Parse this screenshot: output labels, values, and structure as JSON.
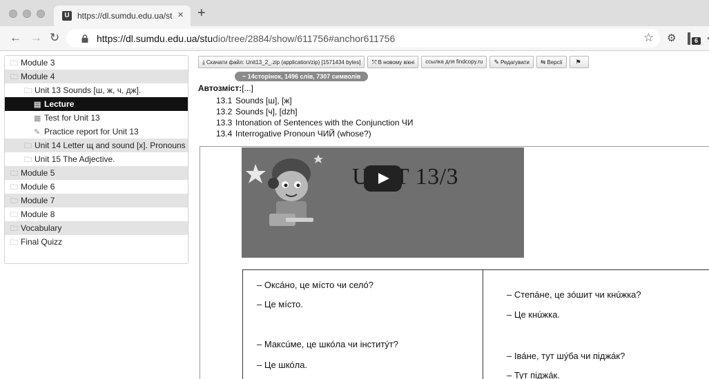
{
  "browser": {
    "tab_title": "https://dl.sumdu.edu.ua/studio",
    "tab_close": "×",
    "new_tab": "+",
    "favicon_glyph": "U",
    "url_host": "https://dl.sumdu.edu.ua/stu",
    "url_path": "dio/tree/2884/show/611756#anchor611756",
    "extension_badge": "6",
    "icons": [
      "back-arrow-icon",
      "forward-arrow-icon",
      "reload-icon",
      "lock-icon",
      "star-icon",
      "extension-icon"
    ]
  },
  "sidebar": {
    "items": [
      {
        "label": "Module 3",
        "level": 0,
        "icon": "folder-icon",
        "shade": false
      },
      {
        "label": "Module 4",
        "level": 0,
        "icon": "folder-icon",
        "shade": true
      },
      {
        "label": "Unit 13 Sounds [ш, ж, ч, дж].",
        "level": 1,
        "icon": "folder-icon",
        "shade": false
      },
      {
        "label": "Lecture",
        "level": 2,
        "icon": "lecture-icon",
        "shade": false,
        "active": true
      },
      {
        "label": "Test for Unit 13",
        "level": 2,
        "icon": "test-icon",
        "shade": false
      },
      {
        "label": "Practice report for Unit 13",
        "level": 2,
        "icon": "report-icon",
        "shade": false
      },
      {
        "label": "Unit 14 Letter щ and sound [x]. Pronouns",
        "level": 1,
        "icon": "folder-icon",
        "shade": true
      },
      {
        "label": "Unit 15 The Adjective.",
        "level": 1,
        "icon": "folder-icon",
        "shade": false
      },
      {
        "label": "Module 5",
        "level": 0,
        "icon": "folder-icon",
        "shade": true
      },
      {
        "label": "Module 6",
        "level": 0,
        "icon": "folder-icon",
        "shade": false
      },
      {
        "label": "Module 7",
        "level": 0,
        "icon": "folder-icon",
        "shade": true
      },
      {
        "label": "Module 8",
        "level": 0,
        "icon": "folder-icon",
        "shade": false
      },
      {
        "label": "Vocabulary",
        "level": 0,
        "icon": "folder-icon",
        "shade": true
      },
      {
        "label": "Final Quizz",
        "level": 0,
        "icon": "folder-icon",
        "shade": false
      }
    ]
  },
  "toolbar": {
    "download": "Скачати файл: Unit13_2_.zip (application/zip) [1571434 bytes]",
    "new_window": "В новому вікні",
    "findcopy": "ссылка для findcopy.ru",
    "edit": "Редагувати",
    "versions": "Версії"
  },
  "stats": "~ 14сторінок, 1496 слів, 7307 символів",
  "autocontent": {
    "label": "Автозміст:",
    "suffix": "[...]",
    "items": [
      {
        "num": "13.1",
        "text": "Sounds [ш], [ж]"
      },
      {
        "num": "13.2",
        "text": "Sounds [ч], [dzh]"
      },
      {
        "num": "13.3",
        "text": "Intonation of Sentences with the Conjunction ЧИ"
      },
      {
        "num": "13.4",
        "text": "Interrogative Pronoun ЧИЙ (whose?)"
      }
    ]
  },
  "video": {
    "title": "UNIT 13/3"
  },
  "dialogues": {
    "left": [
      "– Оксáно, це мíсто чи селó?",
      "– Це мíсто.",
      "– Максúме, це шкóла чи інститýт?",
      "– Це шкóла."
    ],
    "right": [
      "– Степáне,  це зóшит чи кнúжка?",
      "– Це кнúжка.",
      "– Івáне,  тут шýба чи піджáк?",
      "– Тут піджáк."
    ]
  }
}
